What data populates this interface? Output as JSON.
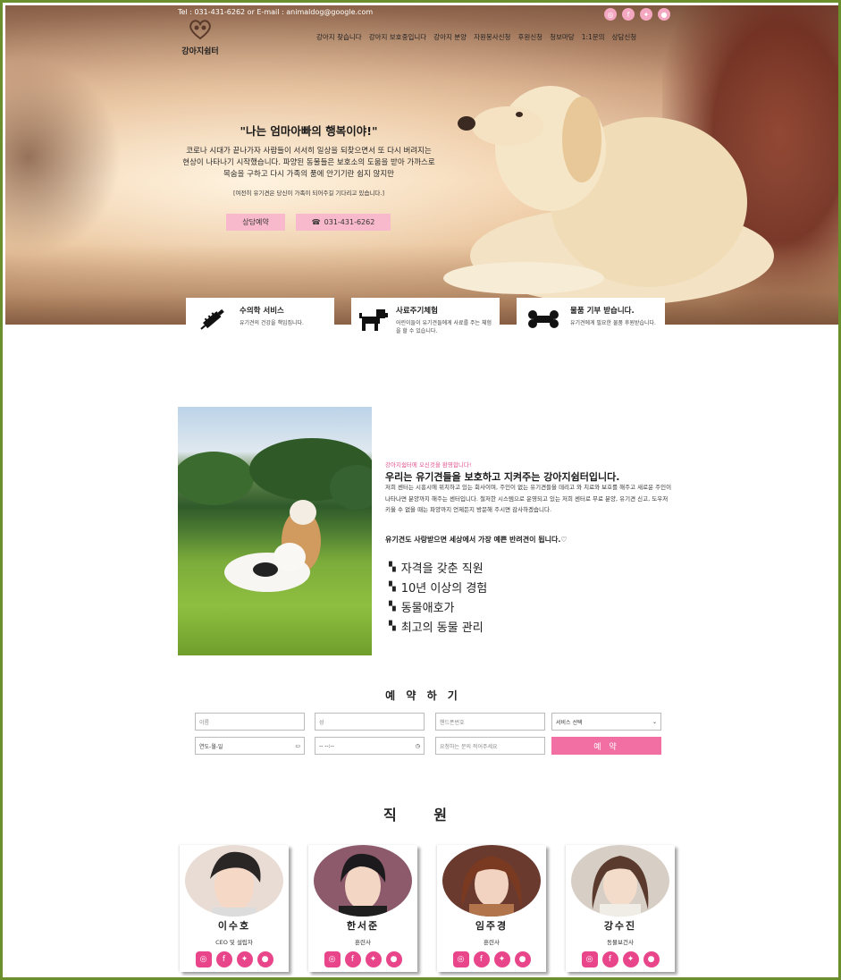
{
  "header": {
    "contact": "Tel : 031-431-6262 or E-mail : animaldog@google.com",
    "logo_text": "강아지쉼터",
    "social": [
      "instagram-icon",
      "facebook-icon",
      "twitter-icon",
      "chat-icon"
    ],
    "nav": [
      "강아지 찾습니다",
      "강아지 보호중입니다",
      "강아지 분양",
      "자원봉사신청",
      "후원신청",
      "청보마당",
      "1:1문의",
      "상담신청"
    ]
  },
  "hero": {
    "title": "\"나는 엄마아빠의 행복이야!\"",
    "desc": "코로나 시대가 끝나가자 사람들이 서서히 일상을 되찾으면서 또 다시 버려지는 현상이 나타나기 시작했습니다. 파양된 동물들은 보호소의 도움을 받아 가까스로 목숨을 구하고 다시 가족의 품에 안기기란 쉽지 않지만",
    "note": "[여전히 유기견은 당신이 가족이 되어주길 기다리고 있습니다.]",
    "btn_consult": "상담예약",
    "btn_phone": "031-431-6262"
  },
  "services": [
    {
      "title": "수의학 서비스",
      "desc": "유기견의 건강을 책임집니다.",
      "icon": "syringe-icon"
    },
    {
      "title": "사료주기체험",
      "desc": "어린이들이 유기견들에게 사료를 주는 체험을 할 수 있습니다.",
      "icon": "dog-icon"
    },
    {
      "title": "물품 기부 받습니다.",
      "desc": "유기견에게 필요한 물품 후원받습니다.",
      "icon": "bone-icon"
    }
  ],
  "about": {
    "small": "강아지쉼터에 오신것을 환영합니다!",
    "title": "우리는 유기견들을 보호하고 지켜주는 강아지쉼터입니다.",
    "desc": "저희 센터는 시흥시에 위치하고 있는 회사이며, 주인이 없는 유기견들을 데리고 와 치료와 보호를 해주고 새로운 주인이 나타나면 분양까지 해주는 센터입니다. 철저한 시스템으로 운영되고 있는 저희 센터로 무료 분양, 유기견 신고, 도우저 키울 수 없을 때는 파양까지 언제든지 방문해 주시면 감사하겠습니다.",
    "love": "유기견도 사랑받으면 세상에서 가장 예쁜 반려견이 됩니다.♡",
    "features": [
      "자격을 갖춘 직원",
      "10년 이상의 경험",
      "동물애호가",
      "최고의 동물 관리"
    ]
  },
  "reservation": {
    "title": "예 약 하 기",
    "name_ph": "이름",
    "email_ph": "성",
    "phone_ph": "핸드폰번호",
    "service_select": "서비스 선택",
    "date_ph": "연도-월-일",
    "time_ph": "-- --:--",
    "request_ph": "요청하는 문의 적어주세요",
    "submit": "예 약"
  },
  "staff": {
    "title": "직 원",
    "members": [
      {
        "name": "이수호",
        "role": "CEO 및 설립자"
      },
      {
        "name": "한서준",
        "role": "훈련사"
      },
      {
        "name": "임주경",
        "role": "훈련사"
      },
      {
        "name": "강수진",
        "role": "동물보건사"
      }
    ]
  },
  "colors": {
    "accent": "#f16fa3",
    "pink_btn": "#f8b9cc",
    "frame": "#6a8f2c"
  }
}
